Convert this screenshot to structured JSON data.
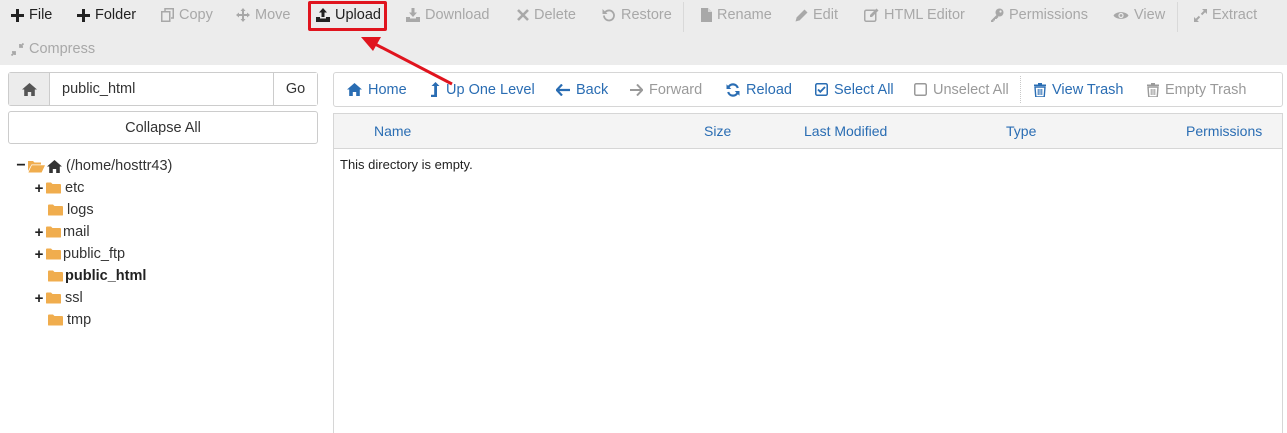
{
  "toolbar": {
    "row1": [
      {
        "key": "file",
        "icon": "plus-icon",
        "label": "File",
        "enabled": true
      },
      {
        "key": "folder",
        "icon": "plus-icon",
        "label": "Folder",
        "enabled": true
      },
      {
        "key": "copy",
        "icon": "copy-icon",
        "label": "Copy",
        "enabled": false
      },
      {
        "key": "move",
        "icon": "move-icon",
        "label": "Move",
        "enabled": false
      },
      {
        "key": "upload",
        "icon": "upload-icon",
        "label": "Upload",
        "enabled": true
      },
      {
        "key": "download",
        "icon": "download-icon",
        "label": "Download",
        "enabled": false
      },
      {
        "key": "delete",
        "icon": "times-icon",
        "label": "Delete",
        "enabled": false
      },
      {
        "key": "restore",
        "icon": "undo-icon",
        "label": "Restore",
        "enabled": false
      },
      {
        "key": "rename",
        "icon": "file-icon",
        "label": "Rename",
        "enabled": false
      },
      {
        "key": "edit",
        "icon": "pencil-icon",
        "label": "Edit",
        "enabled": false
      },
      {
        "key": "html_editor",
        "icon": "edit-square-icon",
        "label": "HTML Editor",
        "enabled": false
      },
      {
        "key": "permissions",
        "icon": "key-icon",
        "label": "Permissions",
        "enabled": false
      },
      {
        "key": "view",
        "icon": "eye-icon",
        "label": "View",
        "enabled": false
      },
      {
        "key": "extract",
        "icon": "expand-icon",
        "label": "Extract",
        "enabled": false
      }
    ],
    "row2": [
      {
        "key": "compress",
        "icon": "compress-icon",
        "label": "Compress",
        "enabled": false
      }
    ]
  },
  "sidebar": {
    "path_value": "public_html",
    "go_label": "Go",
    "collapse_label": "Collapse All",
    "tree": {
      "root_label": "(/home/hosttr43)",
      "items": [
        {
          "name": "etc",
          "expandable": true,
          "current": false
        },
        {
          "name": "logs",
          "expandable": false,
          "current": false
        },
        {
          "name": "mail",
          "expandable": true,
          "current": false
        },
        {
          "name": "public_ftp",
          "expandable": true,
          "current": false
        },
        {
          "name": "public_html",
          "expandable": false,
          "current": true
        },
        {
          "name": "ssl",
          "expandable": true,
          "current": false
        },
        {
          "name": "tmp",
          "expandable": false,
          "current": false
        }
      ]
    }
  },
  "nav": {
    "buttons": [
      {
        "key": "home",
        "icon": "home-icon",
        "label": "Home",
        "enabled": true
      },
      {
        "key": "up",
        "icon": "level-up-icon",
        "label": "Up One Level",
        "enabled": true
      },
      {
        "key": "back",
        "icon": "arrow-left-icon",
        "label": "Back",
        "enabled": true
      },
      {
        "key": "forward",
        "icon": "arrow-right-icon",
        "label": "Forward",
        "enabled": false
      },
      {
        "key": "reload",
        "icon": "refresh-icon",
        "label": "Reload",
        "enabled": true
      },
      {
        "key": "select_all",
        "icon": "check-square-icon",
        "label": "Select All",
        "enabled": true
      },
      {
        "key": "unselect_all",
        "icon": "square-icon",
        "label": "Unselect All",
        "enabled": false
      },
      {
        "key": "view_trash",
        "icon": "trash-icon",
        "label": "View Trash",
        "enabled": true
      },
      {
        "key": "empty_trash",
        "icon": "trash-icon",
        "label": "Empty Trash",
        "enabled": false
      }
    ]
  },
  "table": {
    "headers": [
      "Name",
      "Size",
      "Last Modified",
      "Type",
      "Permissions"
    ],
    "empty_message": "This directory is empty."
  },
  "colors": {
    "accent_blue": "#2a6db3",
    "highlight_red": "#e0141e",
    "folder_orange": "#f0ad4e",
    "disabled_gray": "#a8a8a8"
  }
}
